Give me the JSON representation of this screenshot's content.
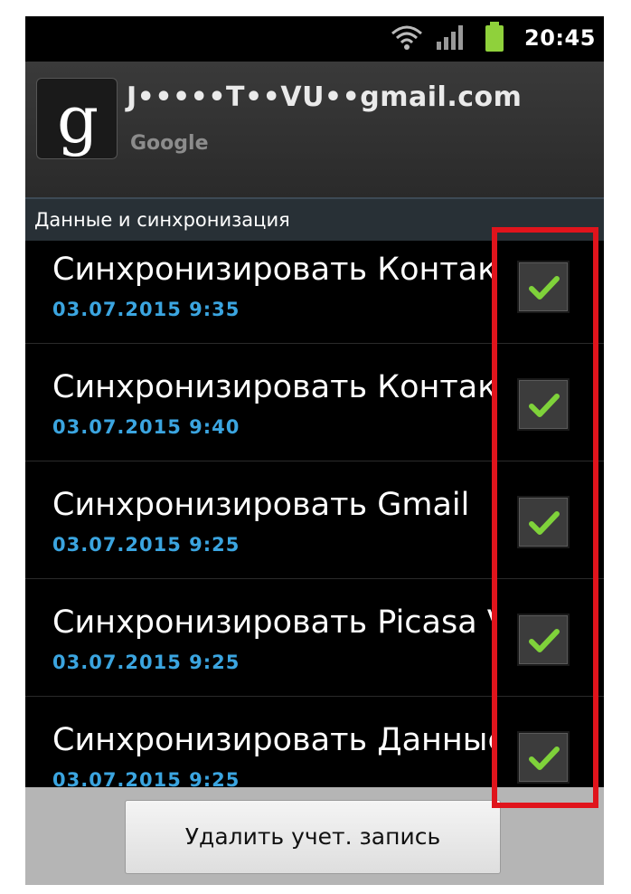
{
  "status_bar": {
    "time": "20:45",
    "wifi_icon": "wifi-icon",
    "signal_icon": "cell-signal-icon",
    "battery_icon": "battery-icon"
  },
  "account": {
    "email": "J•••••T••VU••gmail.com",
    "type": "Google",
    "logo_icon": "google-g-icon"
  },
  "section": {
    "title": "Данные и синхронизация"
  },
  "sync_items": [
    {
      "title": "Синхронизировать Контакты",
      "date": "03.07.2015 9:35",
      "checked": true
    },
    {
      "title": "Синхронизировать Контакты",
      "date": "03.07.2015 9:40",
      "checked": true
    },
    {
      "title": "Синхронизировать Gmail",
      "date": "03.07.2015 9:25",
      "checked": true
    },
    {
      "title": "Синхронизировать Picasa V",
      "date": "03.07.2015 9:25",
      "checked": true
    },
    {
      "title": "Синхронизировать Данные п",
      "date": "03.07.2015 9:25",
      "checked": true
    }
  ],
  "actions": {
    "delete_account": "Удалить учет. запись"
  },
  "colors": {
    "accent_date": "#3ba5e0",
    "checkmark": "#7fd23a",
    "highlight": "#e0141c"
  }
}
